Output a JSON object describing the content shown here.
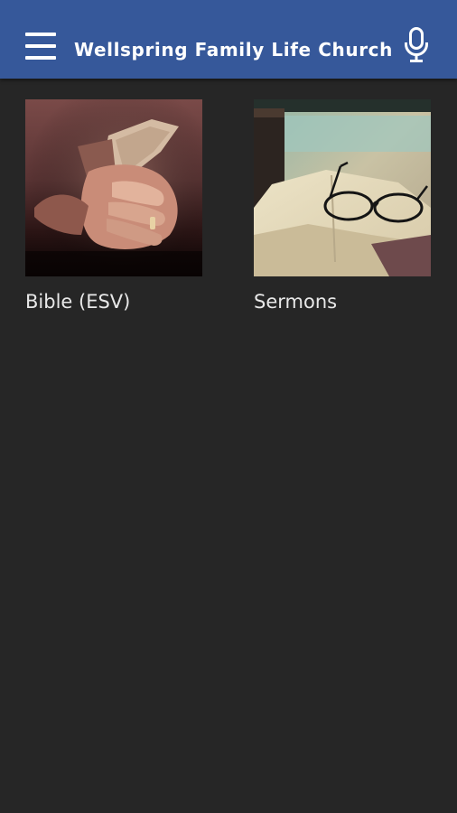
{
  "header": {
    "title": "Wellspring Family Life Church",
    "menu_icon": "hamburger-menu-icon",
    "voice_icon": "microphone-icon",
    "background_color": "#36589a"
  },
  "content": {
    "background_color": "#262626",
    "tiles": [
      {
        "label": "Bible (ESV)",
        "image": "hands-holding-bible-photo"
      },
      {
        "label": "Sermons",
        "image": "glasses-on-open-book-photo"
      }
    ]
  }
}
